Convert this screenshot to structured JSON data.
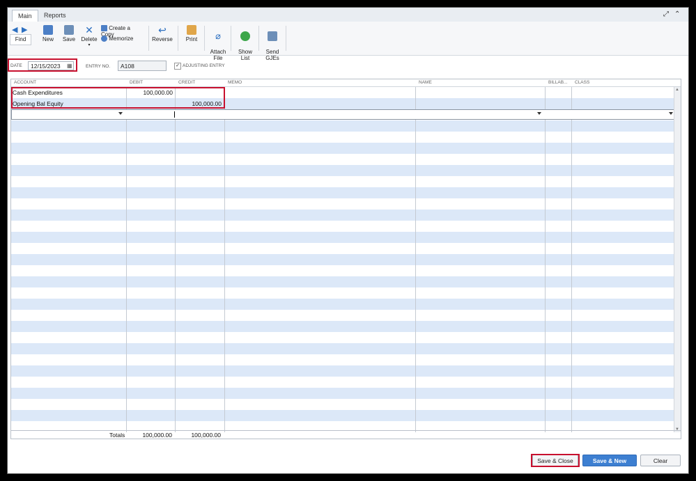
{
  "tabs": {
    "main": "Main",
    "reports": "Reports"
  },
  "toolbar": {
    "find": "Find",
    "new": "New",
    "save": "Save",
    "delete": "Delete",
    "create_copy": "Create a Copy",
    "memorize": "Memorize",
    "reverse": "Reverse",
    "print": "Print",
    "attach_file": "Attach\nFile",
    "show_list": "Show\nList",
    "send_gjes": "Send\nGJEs"
  },
  "header": {
    "date_label": "DATE",
    "date_value": "12/15/2023",
    "entry_label": "ENTRY NO.",
    "entry_value": "A108",
    "adjusting_label": "ADJUSTING ENTRY"
  },
  "columns": [
    "ACCOUNT",
    "DEBIT",
    "CREDIT",
    "MEMO",
    "NAME",
    "BILLAB...",
    "CLASS"
  ],
  "rows": [
    {
      "account": "Cash Expenditures",
      "debit": "100,000.00",
      "credit": ""
    },
    {
      "account": "Opening Bal Equity",
      "debit": "",
      "credit": "100,000.00"
    }
  ],
  "totals": {
    "label": "Totals",
    "debit": "100,000.00",
    "credit": "100,000.00"
  },
  "buttons": {
    "save_close": "Save & Close",
    "save_new": "Save & New",
    "clear": "Clear"
  },
  "colors": {
    "accent": "#3d7fd1",
    "highlight": "#c8102e",
    "row_stripe": "#dce8f8"
  }
}
